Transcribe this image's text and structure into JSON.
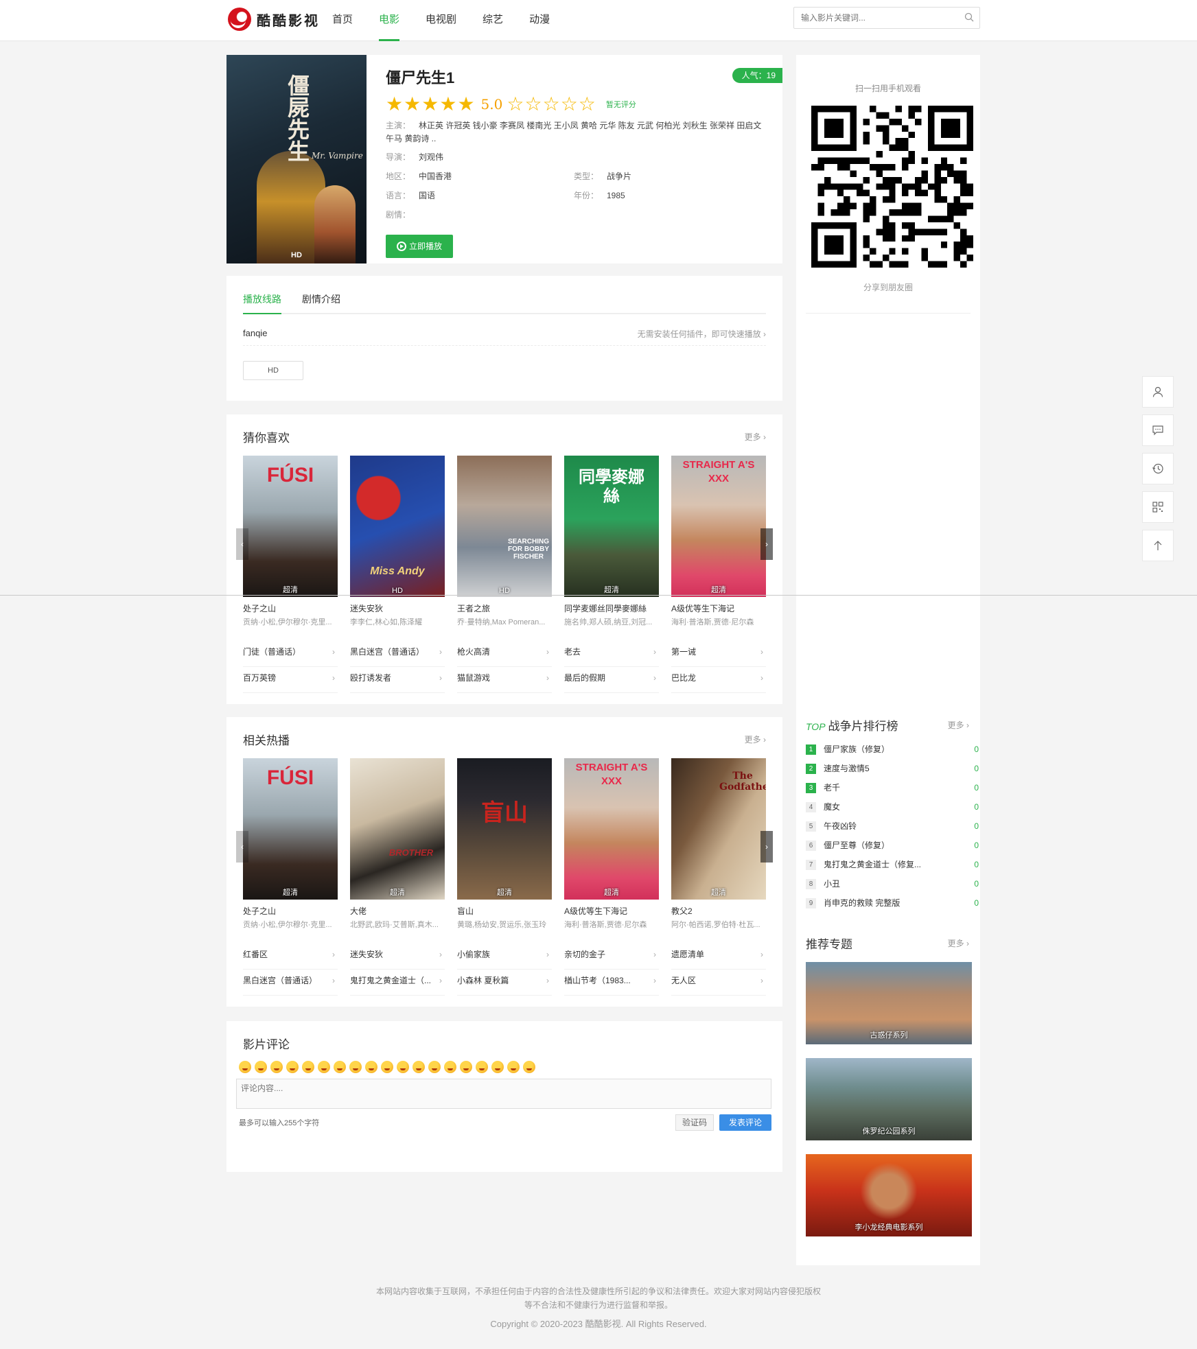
{
  "header": {
    "logo_text": "酷酷影视",
    "nav": [
      "首页",
      "电影",
      "电视剧",
      "综艺",
      "动漫"
    ],
    "active_nav": 1,
    "search_placeholder": "输入影片关键词..."
  },
  "movie": {
    "title": "僵尸先生1",
    "poster_title": "僵屍先生",
    "poster_en": "Mr. Vampire",
    "poster_badge": "HD",
    "popularity": "人气：19",
    "score": "5.0",
    "stars_filled": 5,
    "stars_total": 10,
    "no_rating": "暂无评分",
    "actors_label": "主演：",
    "actors": "林正英 许冠英 钱小豪 李赛凤 楼南光 王小凤 黄哈 元华 陈友 元武 何柏光 刘秋生 张荣祥 田启文 午马 黄韵诗 ..",
    "director_label": "导演：",
    "director": "刘观伟",
    "region_label": "地区：",
    "region": "中国香港",
    "type_label": "类型：",
    "type": "战争片",
    "lang_label": "语言：",
    "lang": "国语",
    "year_label": "年份：",
    "year": "1985",
    "plot_label": "剧情：",
    "play_button": "立即播放"
  },
  "playlist": {
    "tabs": [
      "播放线路",
      "剧情介绍"
    ],
    "source": "fanqie",
    "tip": "无需安装任何插件，即可快速播放",
    "episodes": [
      "HD"
    ]
  },
  "guess": {
    "title": "猜你喜欢",
    "more": "更多",
    "cards": [
      {
        "title": "处子之山",
        "actors": "贡纳·小松,伊尔穆尔·克里...",
        "badge": "超清",
        "ptxt": "FÚSI"
      },
      {
        "title": "迷失安狄",
        "actors": "李李仁,林心如,陈泽耀",
        "badge": "HD",
        "ptxt": "Miss Andy"
      },
      {
        "title": "王者之旅",
        "actors": "乔·曼特纳,Max Pomeran...",
        "badge": "HD",
        "ptxt": "SEARCHING FOR BOBBY FISCHER"
      },
      {
        "title": "同学麦娜丝同學麥娜絲",
        "actors": "施名帅,郑人硕,纳豆,刘冠...",
        "badge": "超清",
        "ptxt": "同學麥娜絲"
      },
      {
        "title": "A级优等生下海记",
        "actors": "海利·普洛斯,贾德·尼尔森",
        "badge": "超清",
        "ptxt": "STRAIGHT A'S XXX"
      }
    ],
    "links": [
      "门徒（普通话）",
      "黑白迷宫（普通话）",
      "枪火高清",
      "老去",
      "第一诫",
      "百万英镑",
      "殴打诱发者",
      "猫鼠游戏",
      "最后的假期",
      "巴比龙"
    ]
  },
  "related": {
    "title": "相关热播",
    "more": "更多",
    "cards": [
      {
        "title": "处子之山",
        "actors": "贡纳·小松,伊尔穆尔·克里...",
        "badge": "超清",
        "ptxt": "FÚSI"
      },
      {
        "title": "大佬",
        "actors": "北野武,欧玛·艾普斯,真木...",
        "badge": "超清",
        "ptxt": "BROTHER"
      },
      {
        "title": "盲山",
        "actors": "黄璐,杨幼安,贺运乐,张玉玲",
        "badge": "超清",
        "ptxt": "盲山"
      },
      {
        "title": "A级优等生下海记",
        "actors": "海利·普洛斯,贾德·尼尔森",
        "badge": "超清",
        "ptxt": "STRAIGHT A'S XXX"
      },
      {
        "title": "教父2",
        "actors": "阿尔·帕西诺,罗伯特·杜瓦...",
        "badge": "超清",
        "ptxt": "The Godfather"
      }
    ],
    "links": [
      "红番区",
      "迷失安狄",
      "小偷家族",
      "亲切的金子",
      "遗愿清单",
      "黑白迷宫（普通话）",
      "鬼打鬼之黄金道士（...",
      "小森林 夏秋篇",
      "楢山节考（1983...",
      "无人区"
    ]
  },
  "comments": {
    "title": "影片评论",
    "placeholder": "评论内容....",
    "limit": "最多可以输入255个字符",
    "captcha": "验证码",
    "submit": "发表评论",
    "emoji_count": 19
  },
  "sidebar": {
    "qr_label": "扫一扫用手机观看",
    "share_label": "分享到朋友圈",
    "rank_top": "TOP",
    "rank_title": "战争片排行榜",
    "more": "更多",
    "ranks": [
      {
        "n": "1",
        "t": "僵尸家族（修复）",
        "v": "0"
      },
      {
        "n": "2",
        "t": "速度与激情5",
        "v": "0"
      },
      {
        "n": "3",
        "t": "老千",
        "v": "0"
      },
      {
        "n": "4",
        "t": "魔女",
        "v": "0"
      },
      {
        "n": "5",
        "t": "午夜凶铃",
        "v": "0"
      },
      {
        "n": "6",
        "t": "僵尸至尊（修复）",
        "v": "0"
      },
      {
        "n": "7",
        "t": "鬼打鬼之黄金道士（修复...",
        "v": "0"
      },
      {
        "n": "8",
        "t": "小丑",
        "v": "0"
      },
      {
        "n": "9",
        "t": "肖申克的救赎 完整版",
        "v": "0"
      }
    ],
    "topic_title": "推荐专题",
    "topics": [
      "古惑仔系列",
      "侏罗纪公园系列",
      "李小龙经典电影系列"
    ]
  },
  "footer": {
    "line1": "本网站内容收集于互联网，不承担任何由于内容的合法性及健康性所引起的争议和法律责任。欢迎大家对网站内容侵犯版权",
    "line2": "等不合法和不健康行为进行监督和举报。",
    "copyright": "Copyright © 2020-2023 酷酷影视. All Rights Reserved."
  },
  "colors": {
    "accent": "#2bb24c",
    "blue": "#3a8ee6",
    "star": "#f5b800"
  }
}
